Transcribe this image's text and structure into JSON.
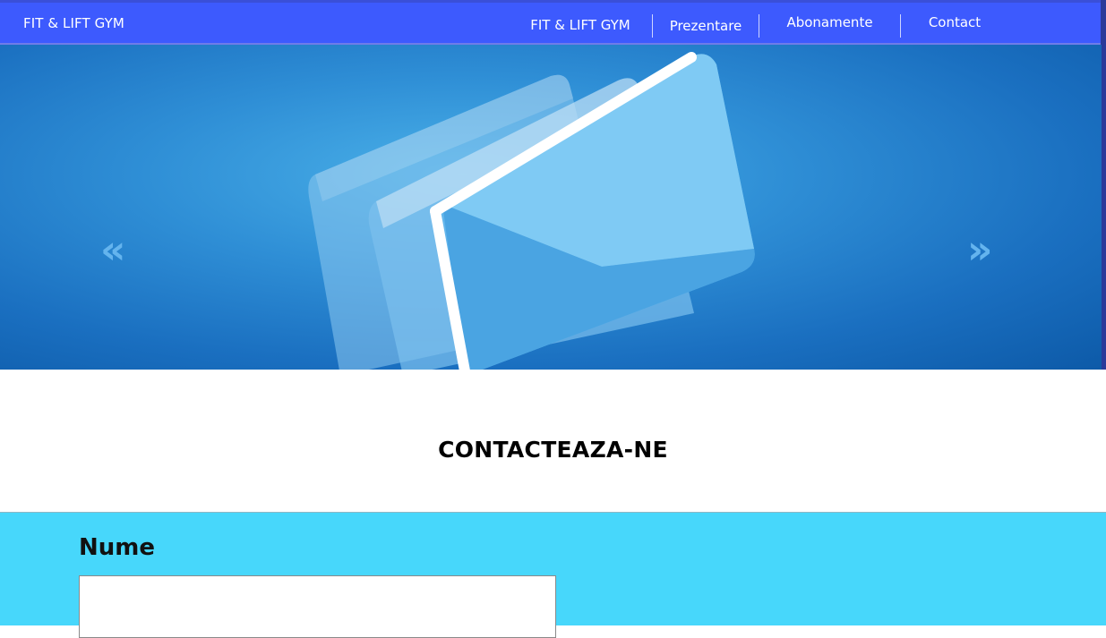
{
  "navbar": {
    "brand": "FIT & LIFT GYM",
    "items": [
      {
        "label": "FIT & LIFT GYM"
      },
      {
        "label": "Prezentare"
      },
      {
        "label": "Abonamente"
      },
      {
        "label": "Contact"
      }
    ]
  },
  "hero": {
    "prev_arrow": "«",
    "next_arrow": "»",
    "image_subject": "envelope-icons"
  },
  "main": {
    "title": "CONTACTEAZA-NE"
  },
  "form": {
    "name_label": "Nume",
    "name_value": ""
  },
  "colors": {
    "navbar": "#3d5afe",
    "form_background": "#47d7fb",
    "hero_blue": "#1a6fc0"
  }
}
